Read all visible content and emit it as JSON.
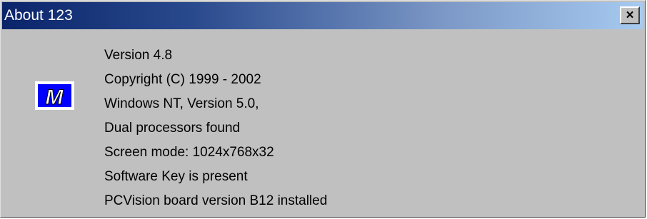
{
  "window": {
    "title": "About 123",
    "close_label": "×"
  },
  "logo": {
    "letter": "M",
    "colors": {
      "fill": "#0000ff",
      "text": "#ffffff",
      "border": "#ffffff"
    }
  },
  "info_lines": [
    "Version 4.8",
    "Copyright (C) 1999 - 2002",
    "Windows NT, Version 5.0,",
    "Dual processors found",
    "Screen mode: 1024x768x32",
    "Software Key is present",
    "PCVision board version B12 installed"
  ],
  "colors": {
    "title_gradient_start": "#0a246a",
    "title_gradient_end": "#a6caf0",
    "background": "#c0c0c0"
  }
}
